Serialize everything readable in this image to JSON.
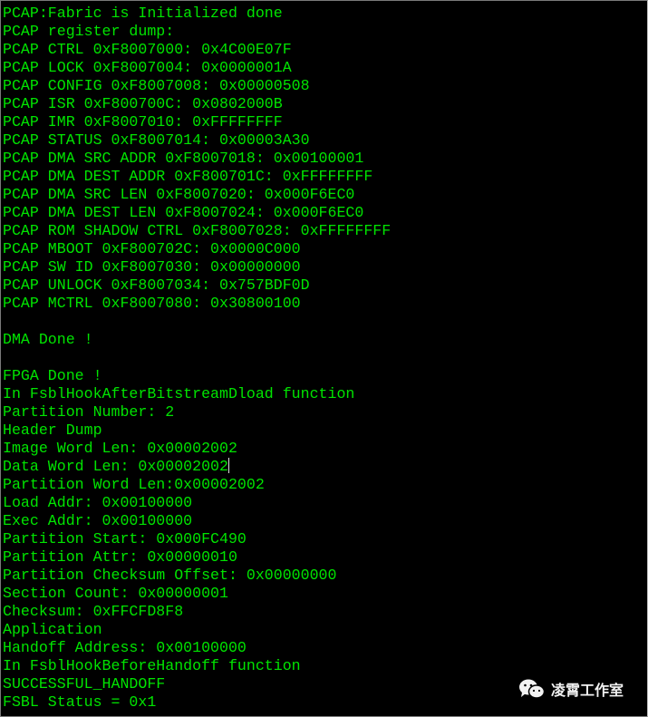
{
  "terminal": {
    "text_color": "#00e400",
    "background": "#000000",
    "cursor_line_index": 24,
    "lines": [
      "PCAP:Fabric is Initialized done",
      "PCAP register dump:",
      "PCAP CTRL 0xF8007000: 0x4C00E07F",
      "PCAP LOCK 0xF8007004: 0x0000001A",
      "PCAP CONFIG 0xF8007008: 0x00000508",
      "PCAP ISR 0xF800700C: 0x0802000B",
      "PCAP IMR 0xF8007010: 0xFFFFFFFF",
      "PCAP STATUS 0xF8007014: 0x00003A30",
      "PCAP DMA SRC ADDR 0xF8007018: 0x00100001",
      "PCAP DMA DEST ADDR 0xF800701C: 0xFFFFFFFF",
      "PCAP DMA SRC LEN 0xF8007020: 0x000F6EC0",
      "PCAP DMA DEST LEN 0xF8007024: 0x000F6EC0",
      "PCAP ROM SHADOW CTRL 0xF8007028: 0xFFFFFFFF",
      "PCAP MBOOT 0xF800702C: 0x0000C000",
      "PCAP SW ID 0xF8007030: 0x00000000",
      "PCAP UNLOCK 0xF8007034: 0x757BDF0D",
      "PCAP MCTRL 0xF8007080: 0x30800100",
      "",
      "DMA Done !",
      "",
      "FPGA Done !",
      "In FsblHookAfterBitstreamDload function",
      "Partition Number: 2",
      "Header Dump",
      "Image Word Len: 0x00002002",
      "Data Word Len: 0x00002002",
      "Partition Word Len:0x00002002",
      "Load Addr: 0x00100000",
      "Exec Addr: 0x00100000",
      "Partition Start: 0x000FC490",
      "Partition Attr: 0x00000010",
      "Partition Checksum Offset: 0x00000000",
      "Section Count: 0x00000001",
      "Checksum: 0xFFCFD8F8",
      "Application",
      "Handoff Address: 0x00100000",
      "In FsblHookBeforeHandoff function",
      "SUCCESSFUL_HANDOFF",
      "FSBL Status = 0x1"
    ]
  },
  "watermark": {
    "icon": "wechat-icon",
    "text": "凌霄工作室"
  }
}
